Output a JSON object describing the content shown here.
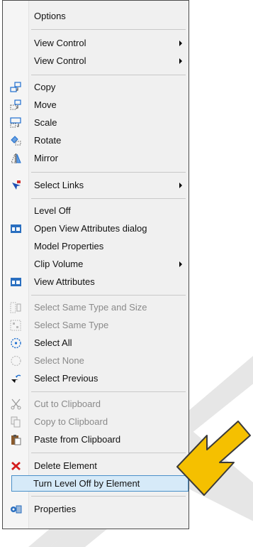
{
  "menu": {
    "items": [
      {
        "label": "Options",
        "icon": "",
        "submenu": false,
        "enabled": true
      },
      {
        "label": "View Control",
        "icon": "",
        "submenu": true,
        "enabled": true
      },
      {
        "label": "View Control",
        "icon": "",
        "submenu": true,
        "enabled": true
      },
      {
        "label": "Copy",
        "icon": "copy-icon",
        "submenu": false,
        "enabled": true
      },
      {
        "label": "Move",
        "icon": "move-icon",
        "submenu": false,
        "enabled": true
      },
      {
        "label": "Scale",
        "icon": "scale-icon",
        "submenu": false,
        "enabled": true
      },
      {
        "label": "Rotate",
        "icon": "rotate-icon",
        "submenu": false,
        "enabled": true
      },
      {
        "label": "Mirror",
        "icon": "mirror-icon",
        "submenu": false,
        "enabled": true
      },
      {
        "label": "Select Links",
        "icon": "select-links-icon",
        "submenu": true,
        "enabled": true
      },
      {
        "label": "Level Off",
        "icon": "",
        "submenu": false,
        "enabled": true
      },
      {
        "label": "Open View Attributes dialog",
        "icon": "view-attributes-icon",
        "submenu": false,
        "enabled": true
      },
      {
        "label": "Model Properties",
        "icon": "",
        "submenu": false,
        "enabled": true
      },
      {
        "label": "Clip Volume",
        "icon": "",
        "submenu": true,
        "enabled": true
      },
      {
        "label": "View Attributes",
        "icon": "view-attributes-icon",
        "submenu": false,
        "enabled": true
      },
      {
        "label": "Select Same Type and Size",
        "icon": "select-same-type-size-icon",
        "submenu": false,
        "enabled": false
      },
      {
        "label": "Select Same Type",
        "icon": "select-same-type-icon",
        "submenu": false,
        "enabled": false
      },
      {
        "label": "Select All",
        "icon": "select-all-icon",
        "submenu": false,
        "enabled": true
      },
      {
        "label": "Select None",
        "icon": "select-none-icon",
        "submenu": false,
        "enabled": false
      },
      {
        "label": "Select Previous",
        "icon": "select-previous-icon",
        "submenu": false,
        "enabled": true
      },
      {
        "label": "Cut to Clipboard",
        "icon": "cut-icon",
        "submenu": false,
        "enabled": false
      },
      {
        "label": "Copy to Clipboard",
        "icon": "copy-clipboard-icon",
        "submenu": false,
        "enabled": false
      },
      {
        "label": "Paste from Clipboard",
        "icon": "paste-icon",
        "submenu": false,
        "enabled": true
      },
      {
        "label": "Delete Element",
        "icon": "delete-icon",
        "submenu": false,
        "enabled": true
      },
      {
        "label": "Turn Level Off by Element",
        "icon": "",
        "submenu": false,
        "enabled": true,
        "highlighted": true
      },
      {
        "label": "Properties",
        "icon": "properties-icon",
        "submenu": false,
        "enabled": true
      }
    ]
  },
  "colors": {
    "highlight_fill": "#d6eaf8",
    "highlight_border": "#4a90c9",
    "pointer_arrow": "#f5c000",
    "disabled_text": "#8a8a8a"
  }
}
